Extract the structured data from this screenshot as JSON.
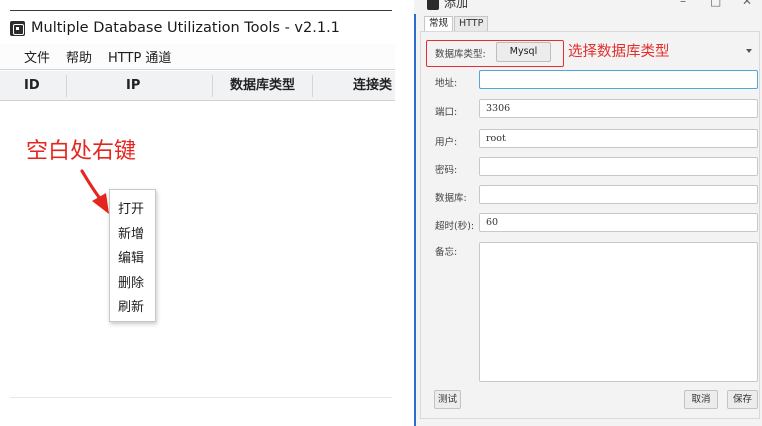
{
  "main_window": {
    "title": "Multiple Database Utilization Tools - v2.1.1",
    "menu": [
      "文件",
      "帮助",
      "HTTP 通道"
    ],
    "table_columns": [
      "ID",
      "IP",
      "数据库类型",
      "连接类"
    ],
    "hint": "空白处右键",
    "context_menu": [
      "打开",
      "新增",
      "编辑",
      "删除",
      "刷新"
    ]
  },
  "dialog": {
    "title": "添加",
    "window_buttons": {
      "minimize": "–",
      "maximize": "□",
      "close": "✕"
    },
    "tabs": [
      "常规",
      "HTTP"
    ],
    "active_tab": 0,
    "db_type": {
      "label": "数据库类型:",
      "value": "Mysql",
      "annotation": "选择数据库类型"
    },
    "fields": {
      "address": {
        "label": "地址:",
        "value": ""
      },
      "port": {
        "label": "端口:",
        "value": "3306"
      },
      "user": {
        "label": "用户:",
        "value": "root"
      },
      "password": {
        "label": "密码:",
        "value": ""
      },
      "database": {
        "label": "数据库:",
        "value": ""
      },
      "timeout": {
        "label": "超时(秒):",
        "value": "60"
      },
      "remark": {
        "label": "备忘:",
        "value": ""
      }
    },
    "buttons": {
      "test": "测试",
      "cancel": "取消",
      "save": "保存"
    }
  },
  "colors": {
    "annotation_red": "#e52e2e",
    "focus_blue": "#54a5d8",
    "dialog_edge_blue": "#2c6bd2"
  },
  "icons": {
    "app_logo": "app-logo-icon",
    "dropdown": "chevron-down-icon",
    "hint_arrow": "arrow-icon"
  }
}
